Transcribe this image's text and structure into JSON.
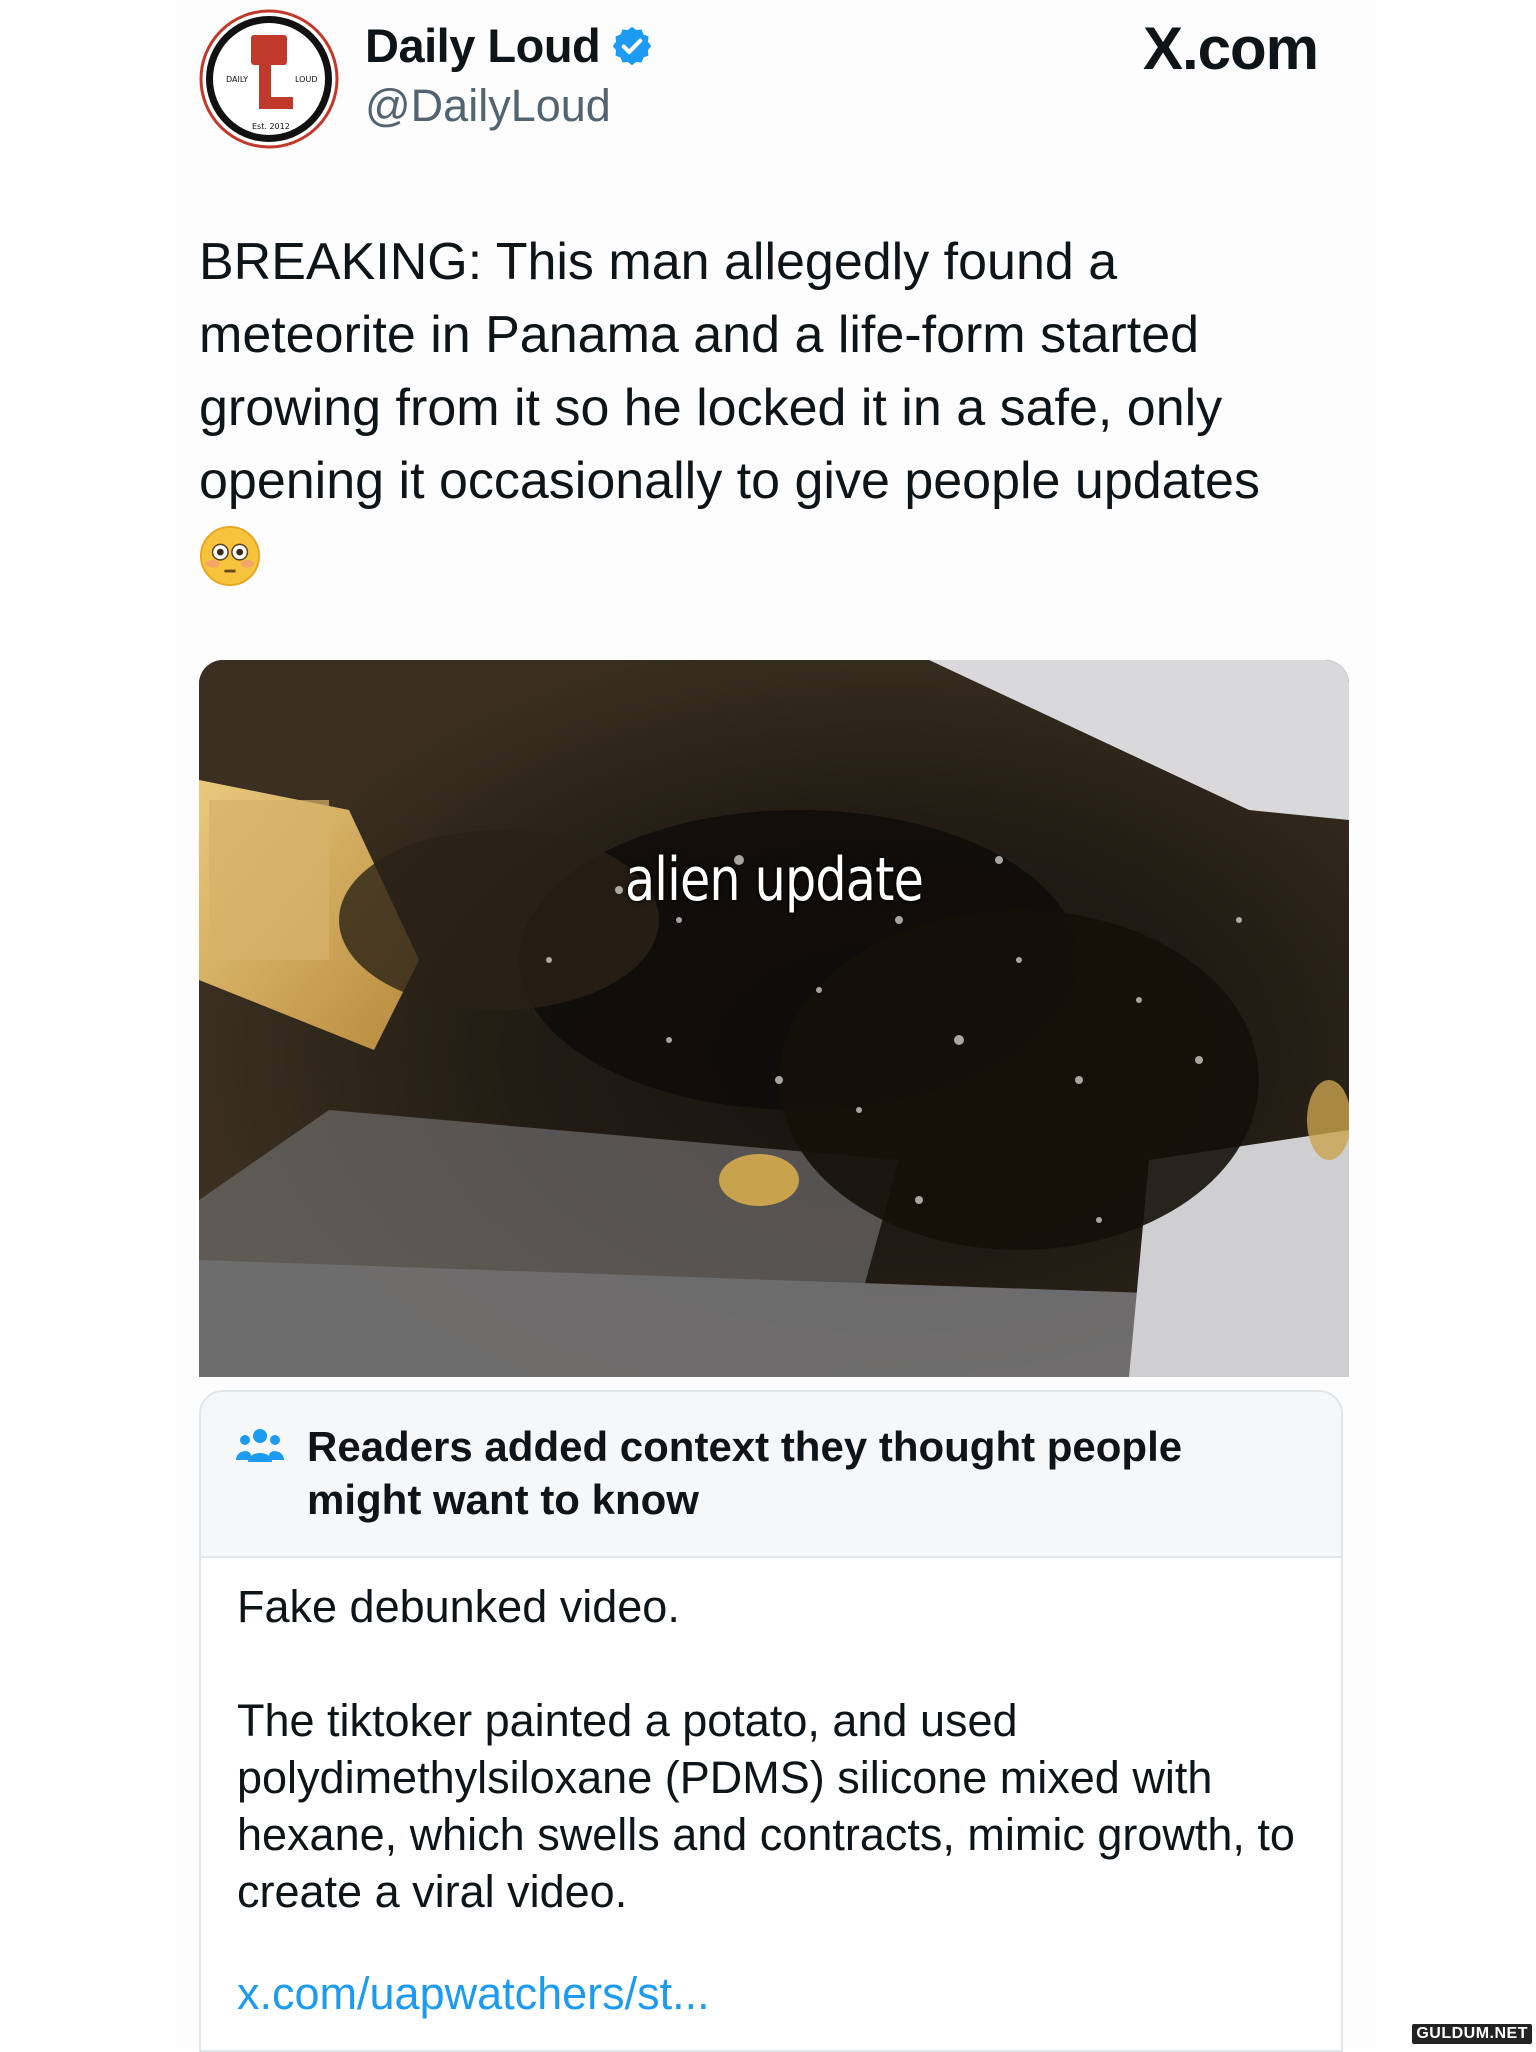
{
  "header": {
    "display_name": "Daily Loud",
    "handle": "@DailyLoud",
    "site_label": "X.com",
    "avatar_logo_text": {
      "left": "DAILY",
      "right": "LOUD",
      "bottom": "Est. 2012"
    },
    "verified_color": "#1d9bf0"
  },
  "tweet": {
    "text": "BREAKING: This man allegedly found a meteorite in Panama and a life-form started growing from it so he locked it in a safe, only opening it occasionally to give people updates",
    "emoji": "flushed-face-emoji"
  },
  "media": {
    "caption": "alien update"
  },
  "community_note": {
    "title": "Readers added context they thought people might want to know",
    "paragraph_1": "Fake debunked video.",
    "paragraph_2": "The tiktoker painted a potato, and used polydimethylsiloxane (PDMS) silicone mixed with hexane, which swells and contracts, mimic growth, to create a viral video.",
    "link": "x.com/uapwatchers/st...",
    "link_color": "#1d9bf0"
  },
  "watermark": {
    "text": "GULDUM.NET"
  }
}
